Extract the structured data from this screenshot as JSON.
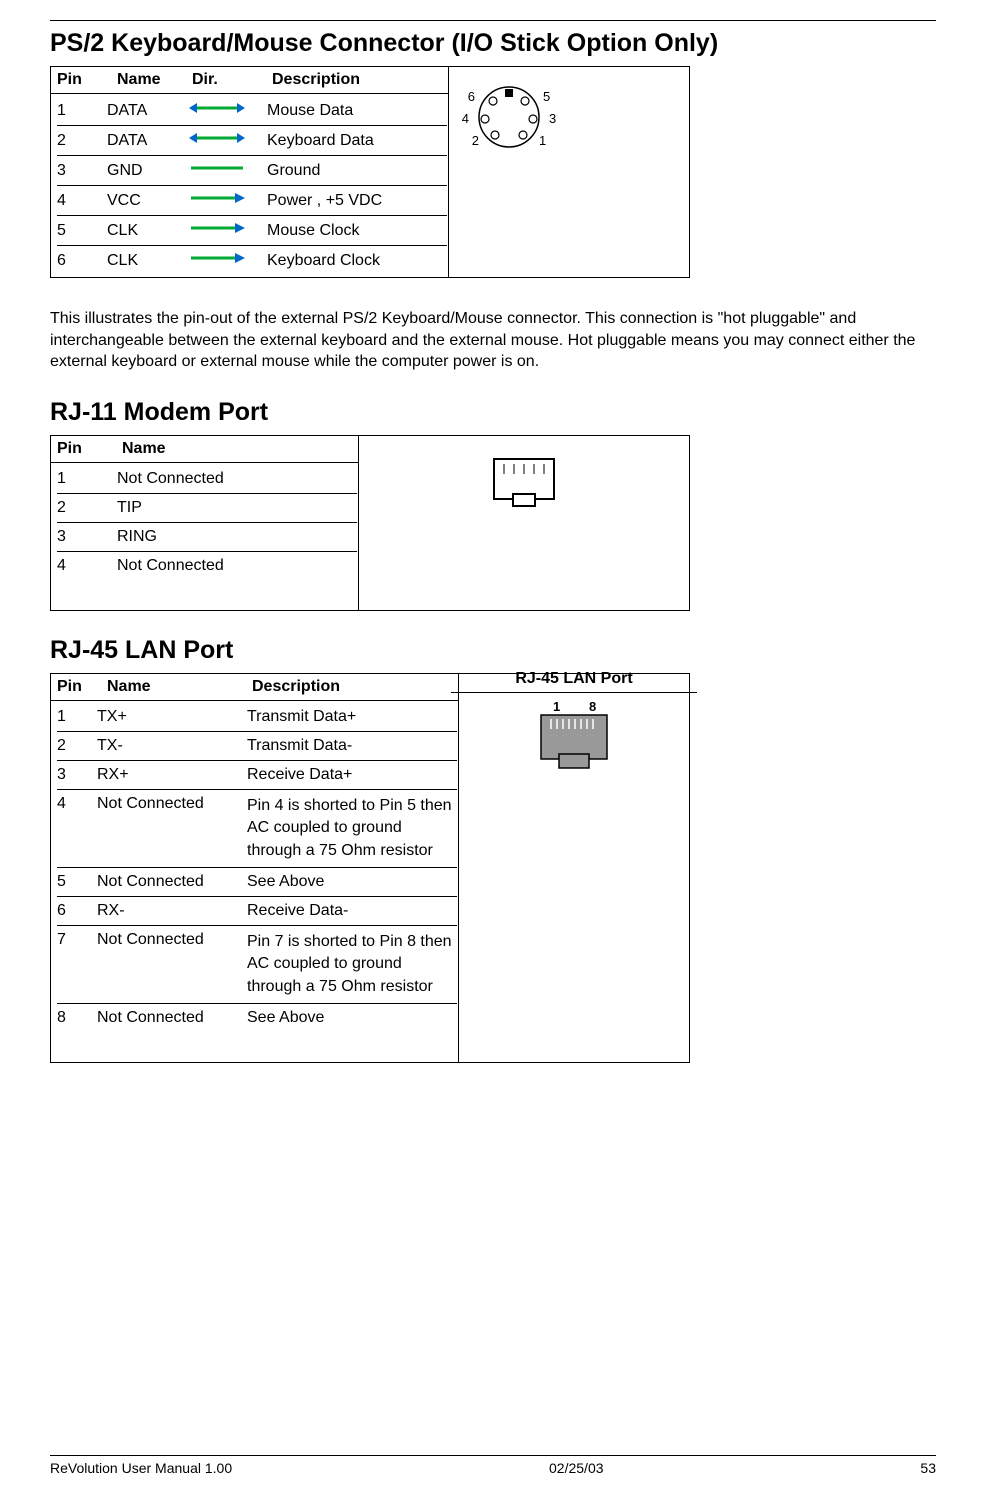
{
  "sections": {
    "ps2": {
      "title": "PS/2 Keyboard/Mouse Connector (I/O Stick Option Only)",
      "headers": {
        "pin": "Pin",
        "name": "Name",
        "dir": "Dir.",
        "desc": "Description"
      },
      "rows": [
        {
          "pin": "1",
          "name": "DATA",
          "dir": "bidir",
          "desc": "Mouse Data"
        },
        {
          "pin": "2",
          "name": "DATA",
          "dir": "bidir",
          "desc": "Keyboard Data"
        },
        {
          "pin": "3",
          "name": "GND",
          "dir": "line",
          "desc": "Ground"
        },
        {
          "pin": "4",
          "name": "VCC",
          "dir": "out",
          "desc": " Power , +5 VDC"
        },
        {
          "pin": "5",
          "name": "CLK",
          "dir": "out",
          "desc": "Mouse Clock"
        },
        {
          "pin": "6",
          "name": "CLK",
          "dir": "out",
          "desc": "Keyboard Clock"
        }
      ],
      "diagram_labels": {
        "tl": "6",
        "tr": "5",
        "ml": "4",
        "mr": "3",
        "bl": "2",
        "br": "1"
      },
      "paragraph": "This illustrates the pin-out of the external PS/2 Keyboard/Mouse connector.  This connection is \"hot pluggable\" and interchangeable between the external keyboard and the external mouse.  Hot pluggable means you may connect either the external keyboard or external mouse while the computer power is on."
    },
    "rj11": {
      "title": "RJ-11 Modem Port",
      "headers": {
        "pin": "Pin",
        "name": "Name"
      },
      "rows": [
        {
          "pin": "1",
          "name": "Not Connected"
        },
        {
          "pin": "2",
          "name": "TIP"
        },
        {
          "pin": "3",
          "name": " RING"
        },
        {
          "pin": "4",
          "name": " Not Connected"
        }
      ]
    },
    "rj45": {
      "title": "RJ-45 LAN Port",
      "headers": {
        "pin": "Pin",
        "name": "Name",
        "desc": "Description",
        "diag": "RJ-45 LAN Port"
      },
      "diagram_labels": {
        "left": "1",
        "right": "8"
      },
      "rows": [
        {
          "pin": "1",
          "name": "TX+",
          "desc": "Transmit Data+"
        },
        {
          "pin": "2",
          "name": "TX-",
          "desc": "Transmit Data-"
        },
        {
          "pin": "3",
          "name": "RX+",
          "desc": " Receive Data+"
        },
        {
          "pin": "4",
          "name": "Not Connected",
          "desc": " Pin 4 is shorted to Pin 5 then AC coupled to ground through a 75 Ohm resistor"
        },
        {
          "pin": "5",
          "name": "Not Connected",
          "desc": "See Above"
        },
        {
          "pin": "6",
          "name": "RX-",
          "desc": " Receive Data-"
        },
        {
          "pin": "7",
          "name": "Not Connected",
          "desc": " Pin 7 is shorted to Pin 8 then AC coupled to ground through a 75 Ohm resistor"
        },
        {
          "pin": "8",
          "name": "Not Connected",
          "desc": "See Above"
        }
      ]
    }
  },
  "footer": {
    "left": "ReVolution User Manual 1.00",
    "center": "02/25/03",
    "right": "53"
  },
  "colors": {
    "arrow_blue": "#0066cc",
    "arrow_green": "#00aa33"
  }
}
